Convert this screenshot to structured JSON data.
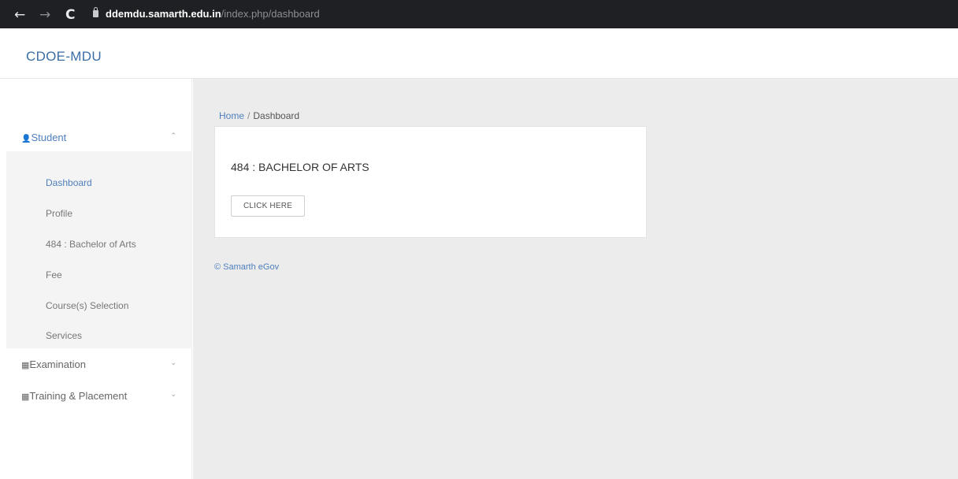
{
  "browser": {
    "back_icon": "←",
    "forward_icon": "→",
    "reload_icon": "C",
    "url_host": "ddemdu.samarth.edu.in",
    "url_path": "/index.php/dashboard"
  },
  "app": {
    "brand": "CDOE-MDU"
  },
  "sidebar": {
    "student": {
      "icon": "👤",
      "label": "Student",
      "caret": "⌃",
      "items": [
        {
          "label": "Dashboard",
          "active": true
        },
        {
          "label": "Profile"
        },
        {
          "label": "484 : Bachelor of Arts"
        },
        {
          "label": "Fee"
        },
        {
          "label": "Course(s) Selection"
        },
        {
          "label": "Services"
        }
      ]
    },
    "examination": {
      "icon": "▦",
      "label": "Examination",
      "caret": "⌄"
    },
    "training": {
      "icon": "▦",
      "label": "Training & Placement",
      "caret": "⌄"
    }
  },
  "breadcrumb": {
    "home": "Home",
    "separator": "/",
    "current": "Dashboard"
  },
  "card": {
    "title": "484 : BACHELOR OF ARTS",
    "button": "CLICK HERE"
  },
  "footer": {
    "text": "© Samarth eGov"
  },
  "colors": {
    "accent": "#4f7fbd",
    "chrome_bg": "#1f2023",
    "content_bg": "#ececec"
  }
}
